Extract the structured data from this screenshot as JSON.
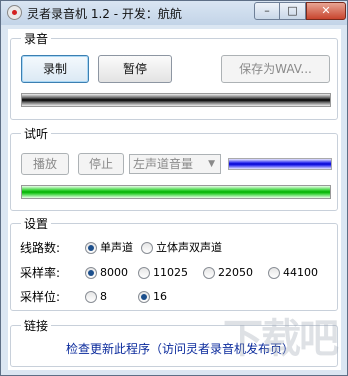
{
  "window": {
    "title": "灵者录音机 1.2 - 开发：航航"
  },
  "titlebar": {
    "min": "–",
    "max": "□",
    "close": "✕"
  },
  "record_group": {
    "title": "录音",
    "record_label": "录制",
    "pause_label": "暂停",
    "save_label": "保存为WAV..."
  },
  "listen_group": {
    "title": "试听",
    "play_label": "播放",
    "stop_label": "停止",
    "channel_select": "左声道音量"
  },
  "settings_group": {
    "title": "设置",
    "channels_label": "线路数:",
    "mono_label": "单声道",
    "stereo_label": "立体声双声道",
    "rate_label": "采样率:",
    "rates": [
      "8000",
      "11025",
      "22050",
      "44100"
    ],
    "bits_label": "采样位:",
    "bits": [
      "8",
      "16"
    ]
  },
  "link_group": {
    "title": "链接",
    "update_link": "检查更新此程序（访问灵者录音机发布页）"
  },
  "watermark": "下载吧"
}
